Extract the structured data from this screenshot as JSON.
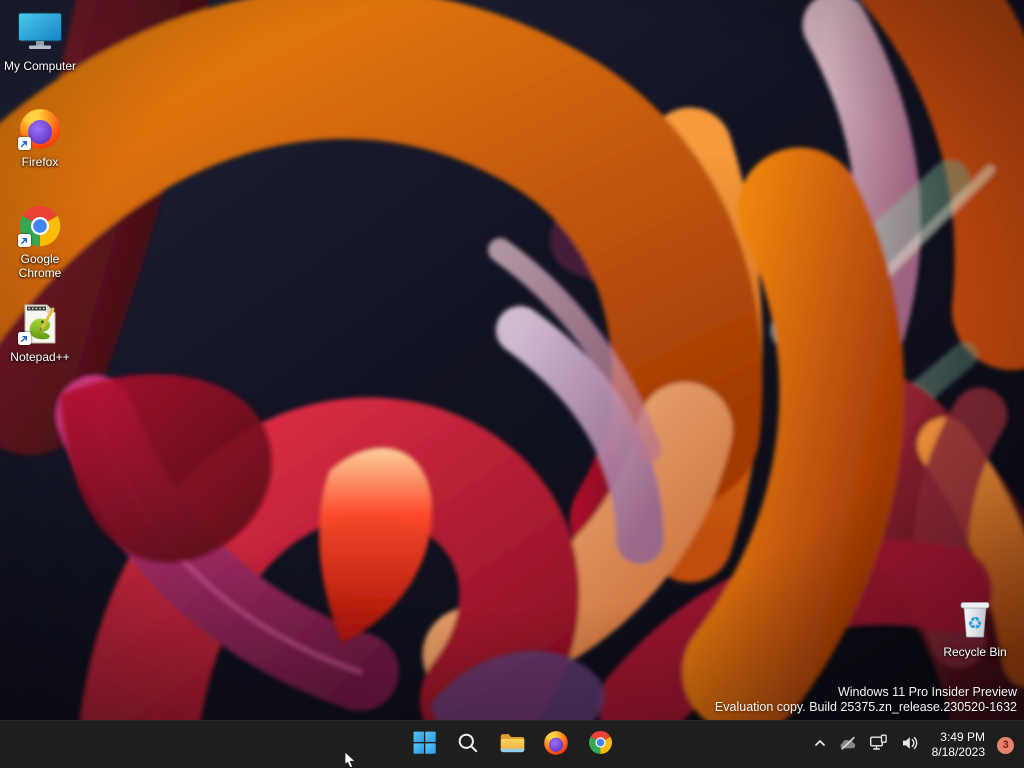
{
  "desktop": {
    "icons": [
      {
        "label": "My Computer",
        "icon": "my-computer-icon",
        "shortcut": false
      },
      {
        "label": "Firefox",
        "icon": "firefox-icon",
        "shortcut": true
      },
      {
        "label": "Google Chrome",
        "icon": "chrome-icon",
        "shortcut": true
      },
      {
        "label": "Notepad++",
        "icon": "notepadpp-icon",
        "shortcut": true
      },
      {
        "label": "Recycle Bin",
        "icon": "recycle-bin-icon",
        "shortcut": false
      }
    ],
    "watermark": {
      "line1": "Windows 11 Pro Insider Preview",
      "line2": "Evaluation copy. Build 25375.zn_release.230520-1632"
    }
  },
  "taskbar": {
    "background": "#1e1e1e",
    "buttons": [
      {
        "name": "start",
        "icon": "windows-start-icon"
      },
      {
        "name": "search",
        "icon": "search-icon"
      },
      {
        "name": "file-explorer",
        "icon": "folder-icon"
      },
      {
        "name": "firefox",
        "icon": "firefox-icon"
      },
      {
        "name": "chrome",
        "icon": "chrome-icon"
      }
    ],
    "tray": {
      "hidden_icons": {
        "icon": "chevron-up-icon"
      },
      "network": {
        "icon": "network-offline-icon"
      },
      "display": {
        "icon": "display-connect-icon"
      },
      "volume": {
        "icon": "speaker-icon"
      },
      "clock": {
        "time": "3:49 PM",
        "date": "8/18/2023"
      },
      "notification_badge": {
        "count": "3",
        "background": "#e8846e",
        "text_color": "#7c1d15"
      }
    }
  },
  "colors": {
    "taskbar_background": "#1e1e1e",
    "wallpaper_base": "#12131f",
    "accent_orange": "#e8760f",
    "accent_crimson": "#b80e2c",
    "accent_magenta": "#c2347a"
  }
}
